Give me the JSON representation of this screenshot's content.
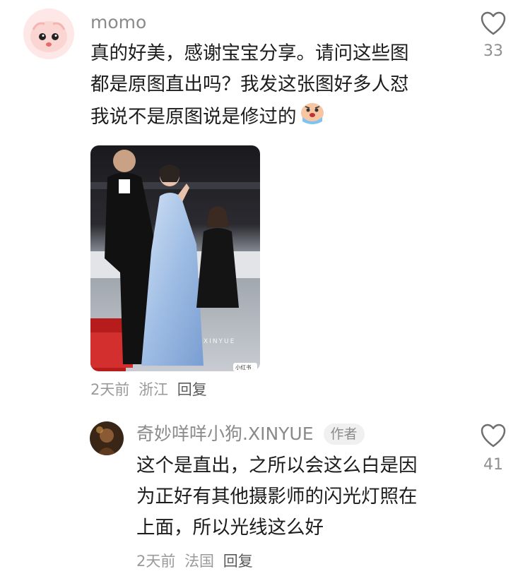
{
  "comment": {
    "username": "momo",
    "lines": [
      "真的好美，感谢宝宝分享。请问这些图",
      "都是原图直出吗？我发这张图好多人怼",
      "我说不是原图说是修过的"
    ],
    "emoji": "crying-face-emoji",
    "like_count": "33",
    "photo": {
      "watermark": "XINYUE",
      "badge": "小红书"
    },
    "time": "2天前",
    "location": "浙江",
    "reply_label": "回复"
  },
  "reply": {
    "username": "奇妙咩咩小狗.XINYUE",
    "author_tag": "作者",
    "lines": [
      "这个是直出，之所以会这么白是因",
      "为正好有其他摄影师的闪光灯照在",
      "上面，所以光线这么好"
    ],
    "like_count": "41",
    "time": "2天前",
    "location": "法国",
    "reply_label": "回复"
  },
  "icons": [
    "heart-outline-icon"
  ],
  "colors": {
    "text": "#1c1c1c",
    "muted": "#8a8a8a",
    "tag_bg": "#f0f0f0"
  }
}
